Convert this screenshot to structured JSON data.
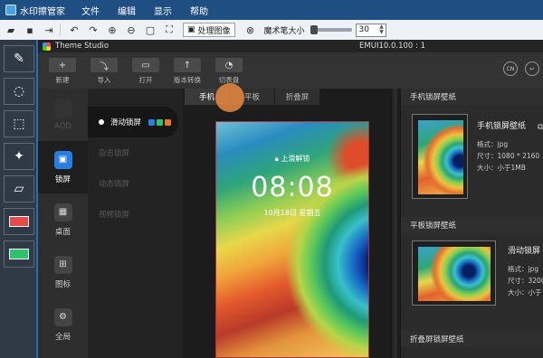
{
  "window": {
    "title": "水印擦管家",
    "menus": [
      "文件",
      "编辑",
      "显示",
      "帮助"
    ]
  },
  "toolbar": {
    "process_label": "处理图像",
    "brush_size_label": "魔术笔大小",
    "brush_size_value": "30"
  },
  "inner": {
    "title": "Theme Studio",
    "version": "EMUI10.0.100 : 1",
    "tools": [
      {
        "icon": "+",
        "label": "新建"
      },
      {
        "icon": "⤵",
        "label": "导入"
      },
      {
        "icon": "▭",
        "label": "打开"
      },
      {
        "icon": "↑",
        "label": "版本转换"
      },
      {
        "icon": "◔",
        "label": "切表盘"
      }
    ],
    "badge_cn": "CN"
  },
  "categories": [
    {
      "label": "AOD",
      "icon": "",
      "state": "dim"
    },
    {
      "label": "锁屏",
      "icon": "▣",
      "state": "active"
    },
    {
      "label": "桌面",
      "icon": "▦",
      "state": "normal"
    },
    {
      "label": "图标",
      "icon": "⊞",
      "state": "normal"
    },
    {
      "label": "全局",
      "icon": "⚙",
      "state": "normal"
    }
  ],
  "subnav": {
    "active": "滑动锁屏",
    "items": [
      "杂志锁屏",
      "动态锁屏",
      "视频锁屏"
    ],
    "chip_colors": [
      "#2a7de1",
      "#2cc36b",
      "#e8742f"
    ]
  },
  "preview": {
    "tabs": [
      "手机",
      "平板",
      "折叠屏"
    ],
    "lock_hint": "上滑解锁",
    "time": "08:08",
    "date": "10月18日 星期五"
  },
  "panel": {
    "phone_section": {
      "title": "手机锁屏壁纸",
      "name": "手机锁屏壁纸",
      "format": "格式：jpg",
      "size": "尺寸：1080 * 2160",
      "filesize": "大小：小于1MB"
    },
    "tablet_section": {
      "title": "平板锁屏壁纸",
      "name": "滑动锁屏",
      "format": "格式：jpg",
      "size": "尺寸：3200",
      "filesize": "大小：小于"
    },
    "fold_section": {
      "title": "折叠屏锁屏壁纸"
    }
  },
  "colors": {
    "accent": "#2a7de1",
    "title_bar": "#1f4f82",
    "swatch_red": "#e84a4a",
    "swatch_green": "#2cc36b"
  }
}
